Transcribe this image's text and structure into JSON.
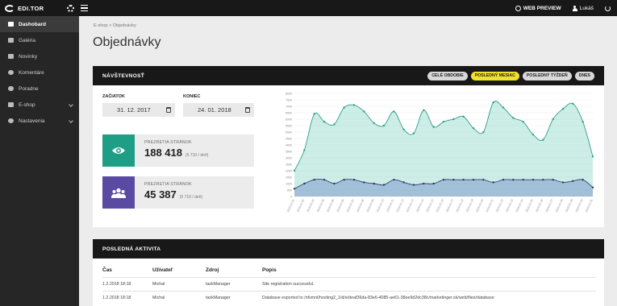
{
  "topbar": {
    "logo": "EDI.TOR",
    "web_preview": "WEB PREVIEW",
    "user": "Lukáš"
  },
  "sidebar": {
    "items": [
      {
        "label": "Dashobard",
        "icon": "dashboard-icon",
        "active": true
      },
      {
        "label": "Galéria",
        "icon": "gallery-icon"
      },
      {
        "label": "Novinky",
        "icon": "news-icon"
      },
      {
        "label": "Komentáre",
        "icon": "comment-icon"
      },
      {
        "label": "Poradne",
        "icon": "users-icon"
      },
      {
        "label": "E-shop",
        "icon": "cart-icon",
        "expandable": true
      },
      {
        "label": "Nastavenia",
        "icon": "settings-icon",
        "expandable": true
      }
    ]
  },
  "breadcrumb": "E-shop > Objednávky",
  "page_title": "Objednávky",
  "visits": {
    "title": "NÁVŠTEVNOSŤ",
    "filters": [
      {
        "label": "CELÉ OBDOBIE",
        "active": false
      },
      {
        "label": "POSLEDNÝ MESIAC",
        "active": true
      },
      {
        "label": "POSLEDNÝ TÝŽDEŇ",
        "active": false
      },
      {
        "label": "DNES",
        "active": false
      }
    ],
    "start_label": "ZAČIATOK",
    "start_value": "31. 12. 2017",
    "end_label": "KONIEC",
    "end_value": "24. 01. 2018",
    "stats": [
      {
        "label": "PREZRETIA STRÁNOK",
        "value": "188 418",
        "sub": "(5 710 / deň)",
        "color": "#1f9e86",
        "icon": "eye-icon"
      },
      {
        "label": "PREZRETIA STRÁNOK",
        "value": "45 387",
        "sub": "(5 710 / deň)",
        "color": "#5b4aa2",
        "icon": "group-icon"
      }
    ]
  },
  "chart_data": {
    "type": "area",
    "ylim": [
      0,
      8000
    ],
    "yticks": [
      "0",
      "500",
      "1000",
      "1500",
      "2000",
      "2500",
      "3000",
      "3500",
      "4000",
      "4500",
      "5000",
      "5500",
      "6000",
      "6500",
      "7000",
      "7500",
      "8000"
    ],
    "x": [
      "2018-01-01",
      "2018-01-02",
      "2018-01-03",
      "2018-01-04",
      "2018-01-05",
      "2018-01-06",
      "2018-01-07",
      "2018-01-08",
      "2018-01-09",
      "2018-01-10",
      "2018-01-11",
      "2018-01-12",
      "2018-01-13",
      "2018-01-14",
      "2018-01-15",
      "2018-01-16",
      "2018-01-17",
      "2018-01-18",
      "2018-01-19",
      "2018-01-20",
      "2018-01-21",
      "2018-01-22",
      "2018-01-23",
      "2018-01-24",
      "2018-01-25",
      "2018-01-26",
      "2018-01-27",
      "2018-01-28",
      "2018-01-29",
      "2018-01-30",
      "2018-01-31"
    ],
    "series": [
      {
        "color": "#63c9b3",
        "values": [
          2000,
          3600,
          6400,
          5800,
          5600,
          6900,
          7100,
          6600,
          5700,
          5500,
          6600,
          5200,
          4900,
          6700,
          5400,
          5800,
          6000,
          6200,
          5300,
          5000,
          7300,
          6900,
          6100,
          5800,
          4800,
          4400,
          6000,
          6800,
          7200,
          5800,
          3100
        ]
      },
      {
        "color": "#6f89c6",
        "values": [
          600,
          1000,
          1300,
          1300,
          1000,
          1300,
          1300,
          1100,
          1000,
          900,
          1300,
          1100,
          900,
          1000,
          1000,
          1300,
          1300,
          1300,
          1300,
          1300,
          1100,
          1300,
          1300,
          1300,
          1300,
          1300,
          1300,
          1100,
          1200,
          1300,
          700
        ]
      }
    ]
  },
  "activity": {
    "title": "POSLEDNÁ AKTIVITA",
    "columns": [
      "Čas",
      "Užívateľ",
      "Zdroj",
      "Popis"
    ],
    "rows": [
      [
        "1.2.2018 18:18",
        "Michal",
        "taskManager",
        "Site registration successful."
      ],
      [
        "1.2.2018 18:18",
        "Michal",
        "taskManager",
        "Database exported to /nfsmnt/hosting2_1/d/e/deaf36da-83e6-4085-ae61-38ee9d2dc38c/marketinger.sk/web/files/database"
      ]
    ]
  }
}
